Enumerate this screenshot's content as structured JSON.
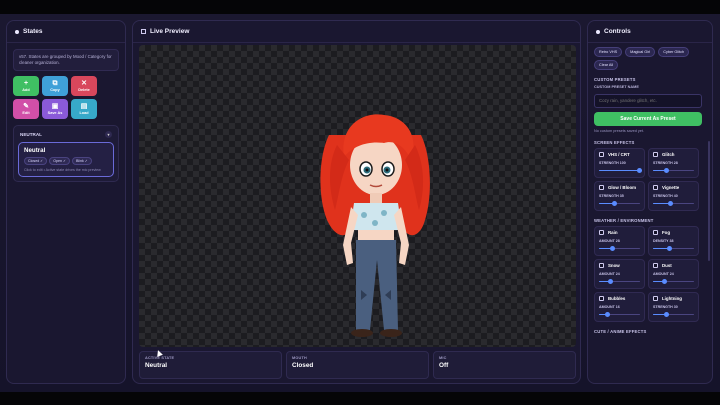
{
  "states_panel": {
    "title": "States",
    "info": "v57. States are grouped by Mood / Category for cleaner organization.",
    "buttons": [
      {
        "key": "add",
        "label": "Add",
        "icon": "+"
      },
      {
        "key": "copy",
        "label": "Copy",
        "icon": "⧉"
      },
      {
        "key": "delete",
        "label": "Delete",
        "icon": "✕"
      },
      {
        "key": "edit",
        "label": "Edit",
        "icon": "✎"
      },
      {
        "key": "save_as",
        "label": "Save As",
        "icon": "▣"
      },
      {
        "key": "load",
        "label": "Load",
        "icon": "▤"
      }
    ],
    "group": {
      "name": "NEUTRAL",
      "card": {
        "name": "Neutral",
        "tags": [
          "Closed ✓",
          "Open ✓",
          "Blink ✓"
        ],
        "hint": "Click to edit • Active state drives the mic preview"
      }
    }
  },
  "preview_panel": {
    "title": "Live Preview",
    "status": [
      {
        "label": "ACTIVE STATE",
        "value": "Neutral"
      },
      {
        "label": "MOUTH",
        "value": "Closed"
      },
      {
        "label": "MIC",
        "value": "Off"
      }
    ]
  },
  "controls_panel": {
    "title": "Controls",
    "preset_chips": [
      "Retro VHS",
      "Magical Girl",
      "Cyber Glitch",
      "Clear All"
    ],
    "custom_presets": {
      "title": "CUSTOM PRESETS",
      "field_label": "CUSTOM PRESET NAME",
      "placeholder": "Cozy rain, yandere glitch, etc.",
      "save_label": "Save Current As Preset",
      "note": "No custom presets saved yet."
    },
    "screen_effects": {
      "title": "SCREEN EFFECTS",
      "items": [
        {
          "name": "VHS / CRT",
          "slider_label": "STRENGTH 100",
          "value": 100
        },
        {
          "name": "Glitch",
          "slider_label": "STRENGTH 28",
          "value": 28
        },
        {
          "name": "Glow / Bloom",
          "slider_label": "STRENGTH 35",
          "value": 35
        },
        {
          "name": "Vignette",
          "slider_label": "STRENGTH 40",
          "value": 40
        }
      ]
    },
    "weather": {
      "title": "WEATHER / ENVIRONMENT",
      "items": [
        {
          "name": "Rain",
          "slider_label": "AMOUNT 28",
          "value": 28
        },
        {
          "name": "Fog",
          "slider_label": "DENSITY 38",
          "value": 38
        },
        {
          "name": "Snow",
          "slider_label": "AMOUNT 24",
          "value": 24
        },
        {
          "name": "Dust",
          "slider_label": "AMOUNT 24",
          "value": 24
        },
        {
          "name": "Bubbles",
          "slider_label": "AMOUNT 16",
          "value": 16
        },
        {
          "name": "Lightning",
          "slider_label": "STRENGTH 30",
          "value": 30
        }
      ]
    },
    "next_section": "CUTE / ANIME EFFECTS"
  },
  "colors": {
    "accent_blue": "#5a8cff",
    "accent_green": "#3fbf63",
    "panel": "#1a1730"
  }
}
